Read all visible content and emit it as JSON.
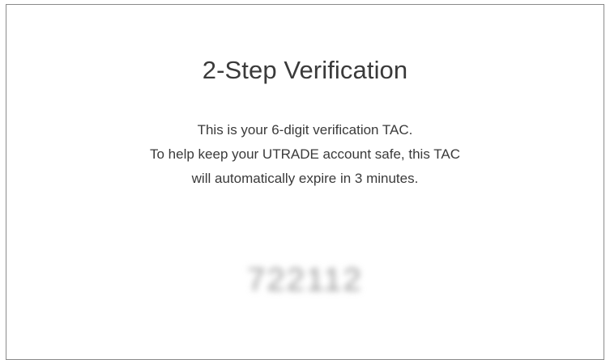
{
  "dialog": {
    "title": "2-Step Verification",
    "message_lines": [
      "This is your 6-digit verification TAC.",
      "To help keep your UTRADE account safe, this TAC",
      "will automatically expire in 3 minutes."
    ],
    "tac_code": "722112",
    "tac_blurred": true
  }
}
